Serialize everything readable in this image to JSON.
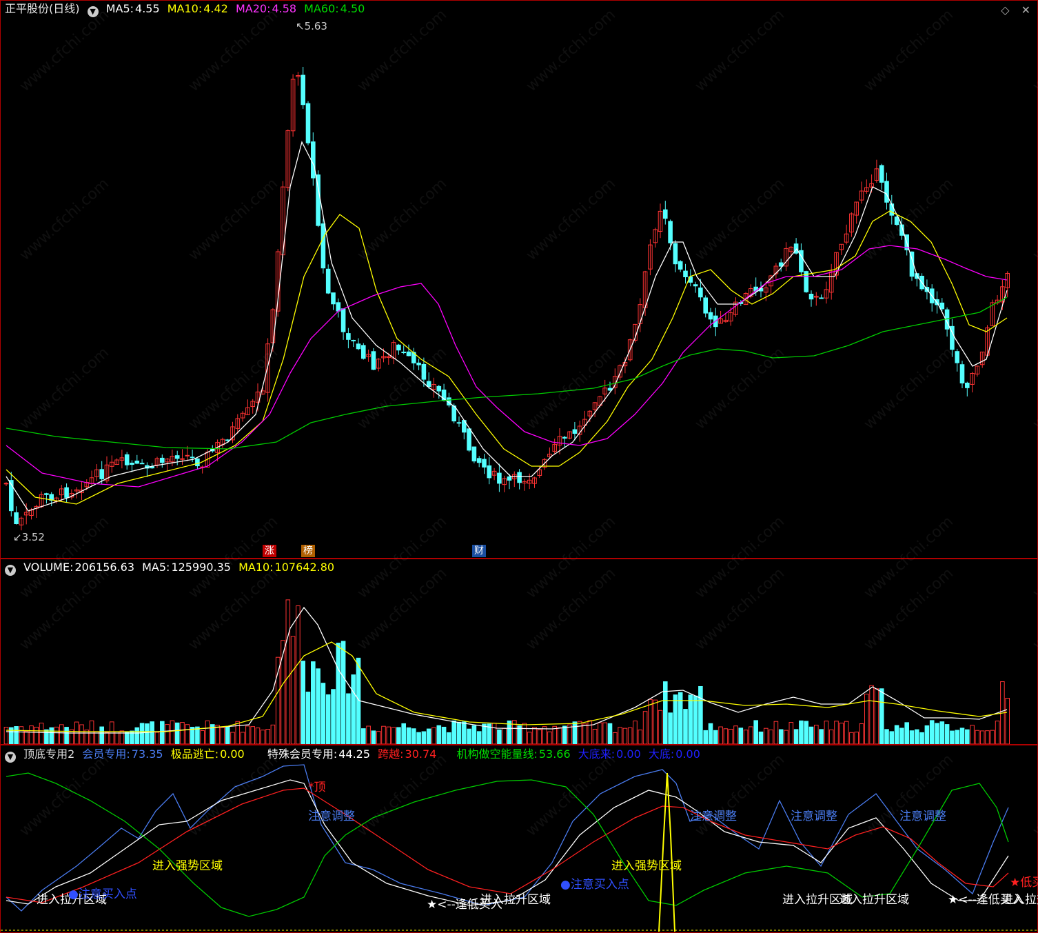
{
  "header": {
    "stock_name": "正平股份(日线)",
    "ma5_label": "MA5:",
    "ma5_value": "4.55",
    "ma10_label": "MA10:",
    "ma10_value": "4.42",
    "ma20_label": "MA20:",
    "ma20_value": "4.58",
    "ma60_label": "MA60:",
    "ma60_value": "4.50",
    "icons": [
      "diamond-icon",
      "close-icon"
    ]
  },
  "price_pane": {
    "high_label": "5.63",
    "low_label": "3.52",
    "tags": [
      {
        "text": "涨",
        "color": "#c00000"
      },
      {
        "text": "榜",
        "color": "#b06000"
      },
      {
        "text": "财",
        "color": "#1a4ea0"
      }
    ],
    "watermark": "www.cfchi.com",
    "colors": {
      "up": "#ff3333",
      "down": "#54ffff",
      "ma5": "#ffffff",
      "ma10": "#ffff00",
      "ma20": "#ff00ff",
      "ma60": "#00cc00"
    }
  },
  "volume_pane": {
    "title": "VOLUME:",
    "value": "206156.63",
    "ma5_label": "MA5:",
    "ma5_value": "125990.35",
    "ma10_label": "MA10:",
    "ma10_value": "107642.80"
  },
  "indicator_pane": {
    "name": "顶底专用2",
    "member_label": "会员专用:",
    "member_value": "73.35",
    "escape_label": "极品逃亡:",
    "escape_value": "0.00",
    "special_label": "特殊会员专用:",
    "special_value": "44.25",
    "cross_label": "跨越:",
    "cross_value": "30.74",
    "inst_label": "机构做空能量线:",
    "inst_value": "53.66",
    "bigbottom_label": "大底来:",
    "bigbottom_value": "0.00",
    "bottom_label": "大底:",
    "bottom_value": "0.00",
    "annotations": {
      "top": "*顶",
      "adjust": "注意调整",
      "strong": "进入强势区域",
      "lift": "进入拉升区域",
      "buy_point": "注意买入点",
      "low_buy": "★<--逢低买入",
      "low_right": "★低买",
      "lift_overlap": "进入拉升区域"
    }
  }
}
